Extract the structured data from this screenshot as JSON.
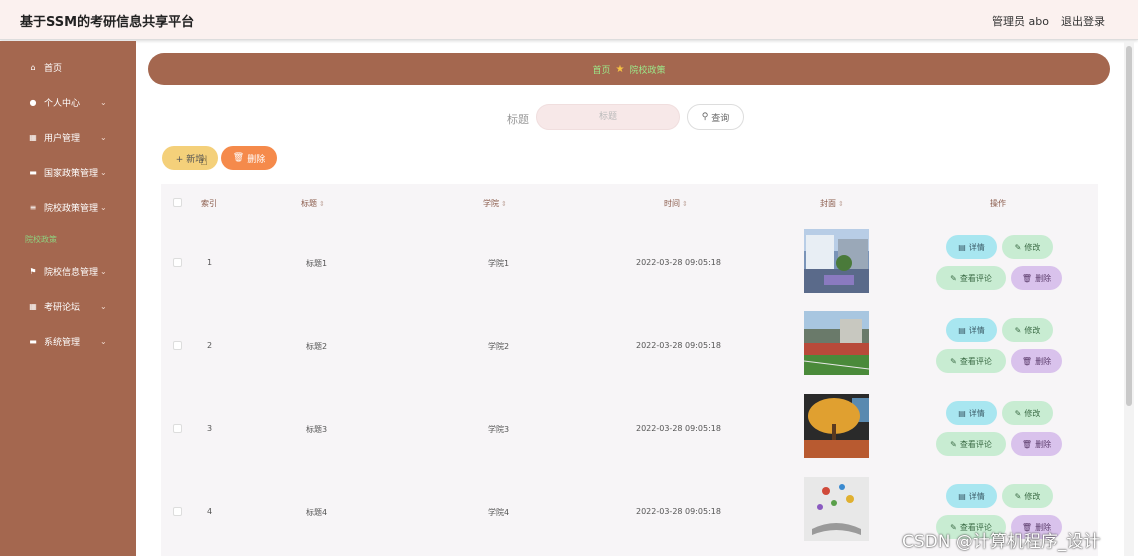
{
  "header": {
    "title": "基于SSM的考研信息共享平台",
    "admin": "管理员 abo",
    "logout": "退出登录"
  },
  "sidebar": {
    "items": [
      {
        "label": "首页",
        "icon": "home-icon",
        "glyph": "⌂",
        "chevron": false
      },
      {
        "label": "个人中心",
        "icon": "user-icon",
        "glyph": "●",
        "chevron": true
      },
      {
        "label": "用户管理",
        "icon": "grid-icon",
        "glyph": "▦",
        "chevron": true
      },
      {
        "label": "国家政策管理",
        "icon": "monitor-icon",
        "glyph": "▬",
        "chevron": true
      },
      {
        "label": "院校政策管理",
        "icon": "list-icon",
        "glyph": "≡",
        "chevron": true
      },
      {
        "label": "院校信息管理",
        "icon": "flag-icon",
        "glyph": "⚑",
        "chevron": true
      },
      {
        "label": "考研论坛",
        "icon": "grid-icon",
        "glyph": "▦",
        "chevron": true
      },
      {
        "label": "系统管理",
        "icon": "chat-icon",
        "glyph": "▬",
        "chevron": true
      }
    ],
    "active_sub": "院校政策"
  },
  "breadcrumb": {
    "home": "首页",
    "current": "院校政策"
  },
  "search": {
    "label": "标题",
    "placeholder": "标题",
    "button": "查询"
  },
  "actions": {
    "add": "+ 新增",
    "delete": "删除"
  },
  "table": {
    "headers": {
      "index": "索引",
      "title": "标题",
      "college": "学院",
      "time": "时间",
      "cover": "封面",
      "ops": "操作"
    },
    "op_labels": {
      "detail": "详情",
      "edit": "修改",
      "review": "查看评论",
      "delete": "删除"
    },
    "rows": [
      {
        "index": "1",
        "title": "标题1",
        "college": "学院1",
        "time": "2022-03-28 09:05:18",
        "cover": "building"
      },
      {
        "index": "2",
        "title": "标题2",
        "college": "学院2",
        "time": "2022-03-28 09:05:18",
        "cover": "stadium"
      },
      {
        "index": "3",
        "title": "标题3",
        "college": "学院3",
        "time": "2022-03-28 09:05:18",
        "cover": "autumn-tree"
      },
      {
        "index": "4",
        "title": "标题4",
        "college": "学院4",
        "time": "2022-03-28 09:05:18",
        "cover": "book-art"
      }
    ]
  },
  "watermark": "CSDN @计算机程序_设计"
}
